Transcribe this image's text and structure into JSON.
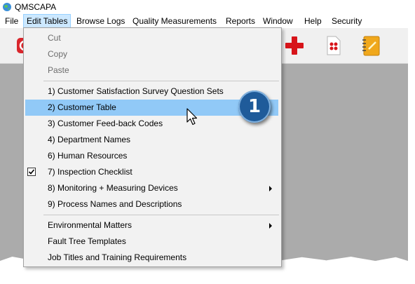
{
  "window": {
    "title": "QMSCAPA"
  },
  "menubar": {
    "items": [
      {
        "label": "File"
      },
      {
        "label": "Edit Tables"
      },
      {
        "label": "Browse Logs"
      },
      {
        "label": "Quality Measurements"
      },
      {
        "label": "Reports"
      },
      {
        "label": "Window"
      },
      {
        "label": "Help"
      },
      {
        "label": "Security"
      }
    ],
    "active_item": "Edit Tables"
  },
  "toolbar": {
    "icons": [
      "exit-icon",
      "add-icon",
      "targets-icon",
      "notebook-icon"
    ],
    "colors": {
      "add": "#d7141a",
      "notebook": "#f0a81c"
    }
  },
  "dropdown": {
    "items": [
      {
        "label": "Cut",
        "enabled": false
      },
      {
        "label": "Copy",
        "enabled": false
      },
      {
        "label": "Paste",
        "enabled": false
      },
      {
        "label": "1) Customer Satisfaction Survey Question Sets"
      },
      {
        "label": "2) Customer Table",
        "highlighted": true
      },
      {
        "label": "3) Customer Feed-back Codes"
      },
      {
        "label": "4) Department Names"
      },
      {
        "label": "6) Human Resources"
      },
      {
        "label": "7) Inspection Checklist",
        "checked": true
      },
      {
        "label": "8) Monitoring + Measuring Devices",
        "submenu": true
      },
      {
        "label": "9) Process Names and Descriptions"
      },
      {
        "label": "Environmental Matters",
        "submenu": true
      },
      {
        "label": "Fault Tree Templates"
      },
      {
        "label": "Job Titles and Training Requirements"
      }
    ],
    "highlight_color": "#91c9f7"
  },
  "callout": {
    "number": "1",
    "color": "#1f5b9a"
  }
}
